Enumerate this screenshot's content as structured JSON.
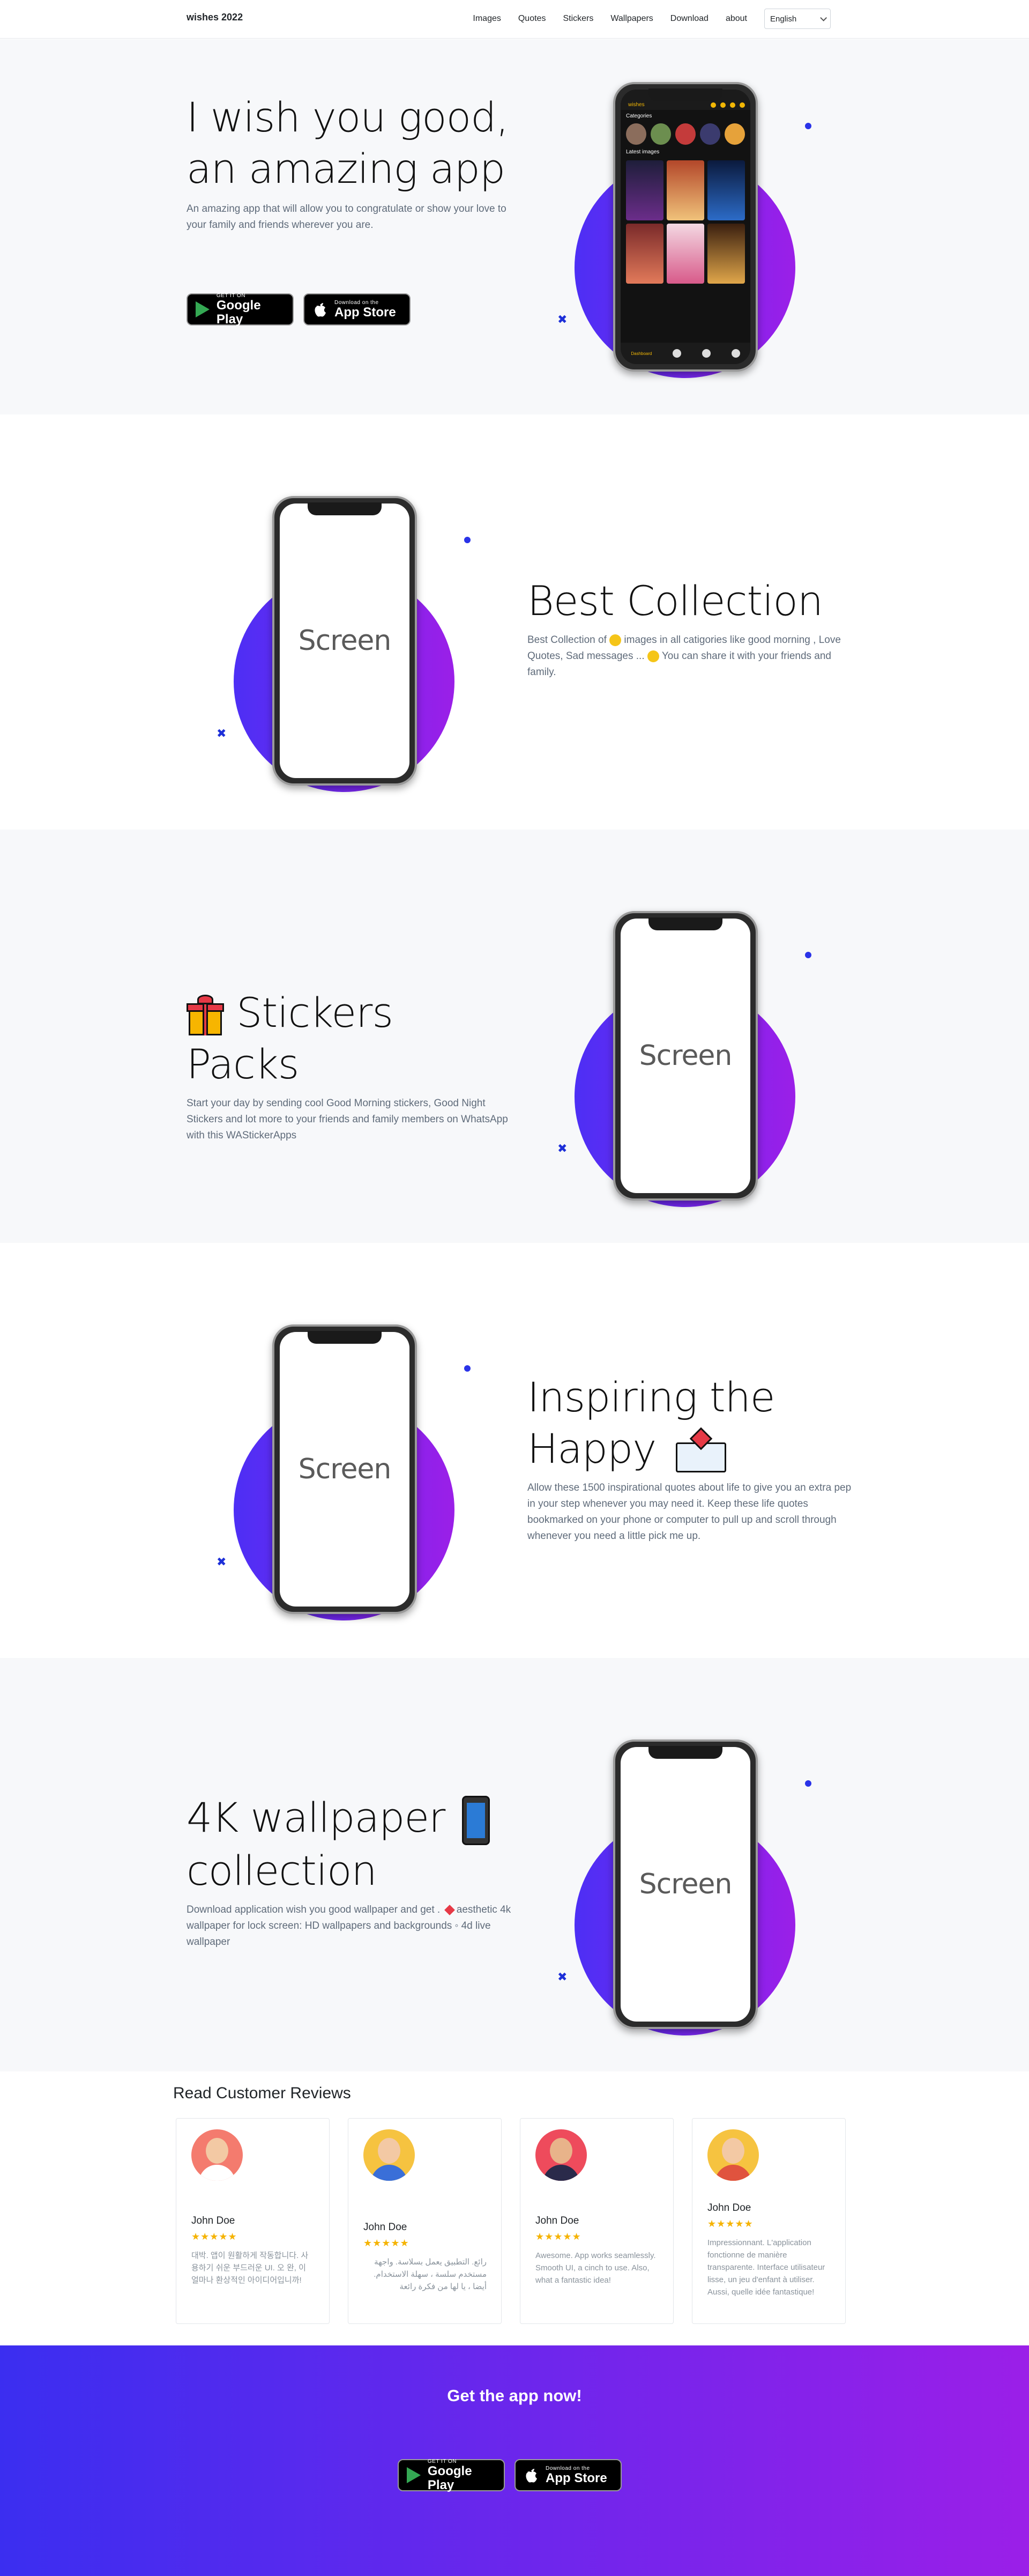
{
  "nav": {
    "brand": "wishes 2022",
    "links": [
      "Images",
      "Quotes",
      "Stickers",
      "Wallpapers",
      "Download",
      "about"
    ],
    "language": "English"
  },
  "hero": {
    "title_line1": "I wish you good,",
    "title_line2": "an amazing app",
    "description": "An amazing app that will allow you to congratulate or show your love to your family and friends wherever you are.",
    "app": {
      "header_title": "wishes",
      "categories_title": "Categories",
      "latest_title": "Latest images",
      "bottom_label": "Dashboard"
    }
  },
  "stores": {
    "google_small": "GET IT ON",
    "google_big": "Google Play",
    "apple_small": "Download on the",
    "apple_big": "App Store"
  },
  "features": [
    {
      "title": "Best Collection",
      "desc_a": "Best Collection of",
      "desc_b": "images in all catigories like good morning , Love Quotes, Sad messages ...",
      "desc_c": "You can share it with your friends and family.",
      "screen": "Screen"
    },
    {
      "title": "Stickers Packs",
      "desc": "Start your day by sending cool Good Morning stickers, Good Night Stickers and lot more to your friends and family members on WhatsApp with this WAStickerApps",
      "screen": "Screen"
    },
    {
      "title_line1": "Inspiring the",
      "title_line2": "Happy",
      "desc": "Allow these 1500 inspirational quotes about life to give you an extra pep in your step whenever you may need it. Keep these life quotes bookmarked on your phone or computer to pull up and scroll through whenever you need a little pick me up.",
      "screen": "Screen"
    },
    {
      "title_line1": "4K wallpaper",
      "title_line2": "collection",
      "desc_a": "Download application wish you good wallpaper and get .",
      "desc_b": "aesthetic 4k wallpaper for lock screen: HD wallpapers and backgrounds ◦ 4d live wallpaper",
      "screen": "Screen"
    }
  ],
  "reviews": {
    "title": "Read Customer Reviews",
    "items": [
      {
        "name": "John Doe",
        "stars": "★★★★★",
        "text": "대박. 앱이 원활하게 작동합니다. 사용하기 쉬운 부드러운 UI. 오 완, 이 얼마나 환상적인 아이디어입니까!"
      },
      {
        "name": "John Doe",
        "stars": "★★★★★",
        "text": "رائع. التطبيق يعمل بسلاسة. واجهة مستخدم سلسة ، سهلة الاستخدام. أيضا ، يا لها من فكرة رائعة"
      },
      {
        "name": "John Doe",
        "stars": "★★★★★",
        "text": "Awesome. App works seamlessly. Smooth UI, a cinch to use. Also, what a fantastic idea!"
      },
      {
        "name": "John Doe",
        "stars": "★★★★★",
        "text": "Impressionnant. L'application fonctionne de manière transparente. Interface utilisateur lisse, un jeu d'enfant à utiliser. Aussi, quelle idée fantastique!"
      }
    ]
  },
  "cta": {
    "title": "Get the app now!"
  }
}
